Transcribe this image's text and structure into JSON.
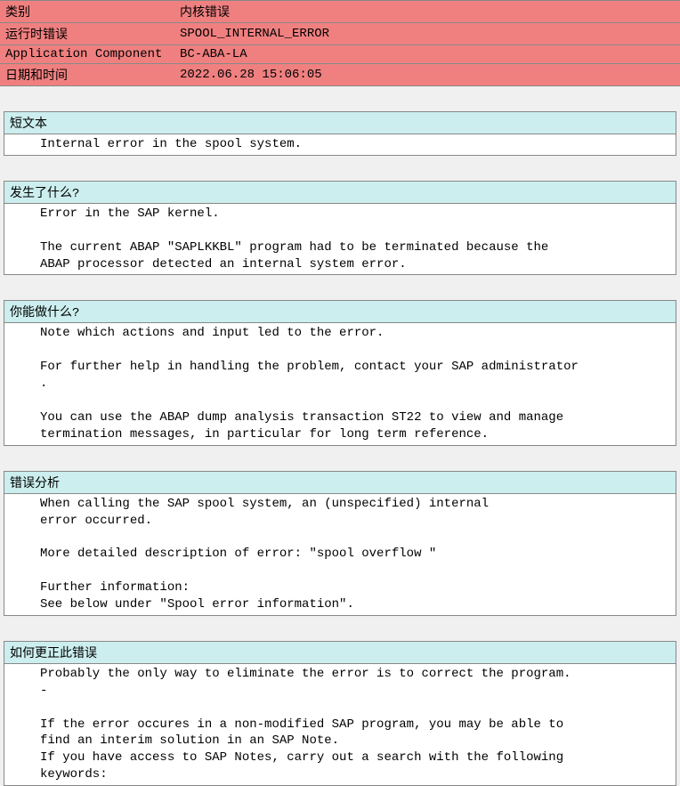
{
  "header": {
    "rows": [
      {
        "label": "类别",
        "value": "内核错误"
      },
      {
        "label": "运行时错误",
        "value": "SPOOL_INTERNAL_ERROR"
      },
      {
        "label": "Application Component",
        "value": "BC-ABA-LA"
      },
      {
        "label": "日期和时间",
        "value": "2022.06.28 15:06:05"
      }
    ]
  },
  "sections": {
    "short_text": {
      "title": "短文本",
      "body": "Internal error in the spool system."
    },
    "what_happened": {
      "title": "发生了什么?",
      "body": "Error in the SAP kernel.\n\nThe current ABAP \"SAPLKKBL\" program had to be terminated because the\nABAP processor detected an internal system error."
    },
    "what_can_you_do": {
      "title": "你能做什么?",
      "body": "Note which actions and input led to the error.\n\nFor further help in handling the problem, contact your SAP administrator\n.\n\nYou can use the ABAP dump analysis transaction ST22 to view and manage\ntermination messages, in particular for long term reference."
    },
    "error_analysis": {
      "title": "错误分析",
      "body": "When calling the SAP spool system, an (unspecified) internal\nerror occurred.\n\nMore detailed description of error: \"spool overflow \"\n\nFurther information:\nSee below under \"Spool error information\"."
    },
    "how_to_correct": {
      "title": "如何更正此错误",
      "body": "Probably the only way to eliminate the error is to correct the program.\n-\n\nIf the error occures in a non-modified SAP program, you may be able to\nfind an interim solution in an SAP Note.\nIf you have access to SAP Notes, carry out a search with the following\nkeywords:"
    }
  }
}
